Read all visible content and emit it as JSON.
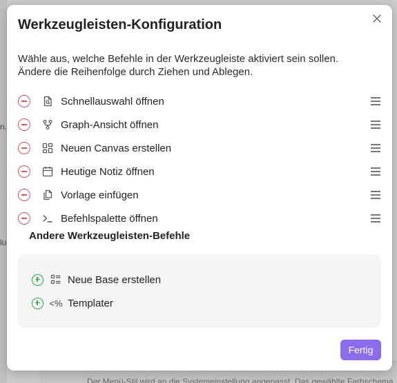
{
  "background": {
    "fragments": [
      "n.",
      "lu"
    ],
    "bottom_text": "Der Menü-Stil wird an die Systemeinstellung angepasst. Das gewählte Farbschema"
  },
  "modal": {
    "title": "Werkzeugleisten-Konfiguration",
    "description_line1": "Wähle aus, welche Befehle in der Werkzeugleiste aktiviert sein sollen.",
    "description_line2": "Ändere die Reihenfolge durch Ziehen und Ablegen.",
    "active_commands": [
      {
        "label": "Schnellauswahl öffnen",
        "icon": "file-search-icon"
      },
      {
        "label": "Graph-Ansicht öffnen",
        "icon": "git-fork-icon"
      },
      {
        "label": "Neuen Canvas erstellen",
        "icon": "layout-dashboard-icon"
      },
      {
        "label": "Heutige Notiz öffnen",
        "icon": "calendar-icon"
      },
      {
        "label": "Vorlage einfügen",
        "icon": "files-icon"
      },
      {
        "label": "Befehlspalette öffnen",
        "icon": "terminal-icon"
      }
    ],
    "other_section_title": "Andere Werkzeugleisten-Befehle",
    "other_commands": [
      {
        "label": "Neue Base erstellen",
        "icon": "list-layout-icon"
      },
      {
        "label": "Templater",
        "icon_text": "<%",
        "icon": "templater-icon"
      }
    ],
    "done_label": "Fertig"
  },
  "colors": {
    "remove": "#e0525b",
    "add": "#2fa84f",
    "accent": "#8b6cef"
  }
}
